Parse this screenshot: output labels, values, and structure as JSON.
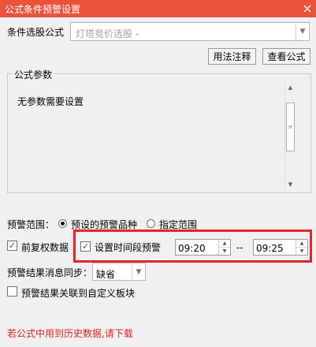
{
  "window": {
    "title": "公式条件预警设置",
    "close_glyph": "×"
  },
  "formula": {
    "label": "条件选股公式",
    "selected": "灯塔竞价选股 -",
    "arrow": "▼"
  },
  "buttons": {
    "usage": "用法注释",
    "view": "查看公式"
  },
  "params": {
    "group_title": "公式参数",
    "empty_text": "无参数需要设置",
    "scroll_up": "▲",
    "scroll_thumb": "≡",
    "scroll_down": "▼"
  },
  "range": {
    "label": "预警范围：",
    "option_preset": "预设的预警品种",
    "option_custom": "指定范围",
    "selected": "option_preset"
  },
  "adjust": {
    "label": "前复权数据",
    "checked": true,
    "glyph": "✓"
  },
  "time_warning": {
    "label": "设置时间段预警",
    "checked": true,
    "start": "09:20",
    "separator": "--",
    "end": "09:25",
    "spin_up": "▲",
    "spin_down": "▼"
  },
  "sync": {
    "label": "预警结果消息同步：",
    "value": "缺省",
    "arrow": "▼"
  },
  "link": {
    "label": "预警结果关联到自定义板块",
    "checked": false
  },
  "warning": {
    "text": "若公式中用到历史数据,请下载"
  }
}
